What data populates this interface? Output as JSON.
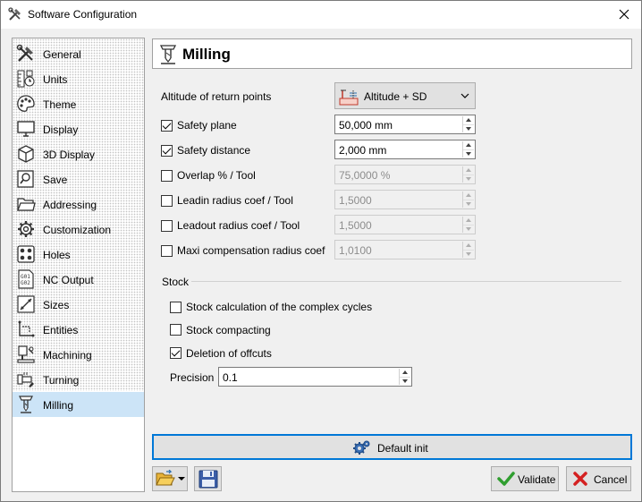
{
  "window": {
    "title": "Software Configuration"
  },
  "sidebar": {
    "items": [
      {
        "label": "General",
        "icon": "tools-icon"
      },
      {
        "label": "Units",
        "icon": "ruler-icon"
      },
      {
        "label": "Theme",
        "icon": "palette-icon"
      },
      {
        "label": "Display",
        "icon": "monitor-icon"
      },
      {
        "label": "3D Display",
        "icon": "cube-icon"
      },
      {
        "label": "Save",
        "icon": "save-magnifier-icon"
      },
      {
        "label": "Addressing",
        "icon": "folder-open-icon"
      },
      {
        "label": "Customization",
        "icon": "gear-icon"
      },
      {
        "label": "Holes",
        "icon": "holes-icon"
      },
      {
        "label": "NC Output",
        "icon": "gcode-file-icon"
      },
      {
        "label": "Sizes",
        "icon": "dimension-icon"
      },
      {
        "label": "Entities",
        "icon": "entities-icon"
      },
      {
        "label": "Machining",
        "icon": "machining-icon"
      },
      {
        "label": "Turning",
        "icon": "lathe-icon"
      },
      {
        "label": "Milling",
        "icon": "mill-icon"
      }
    ],
    "selected": "Milling"
  },
  "header": {
    "title": "Milling",
    "icon": "mill-icon"
  },
  "form": {
    "altitude": {
      "label": "Altitude of return points",
      "value": "Altitude + SD",
      "icon": "altitude-icon"
    },
    "safety_plane": {
      "label": "Safety plane",
      "value": "50,000 mm",
      "checked": true
    },
    "safety_distance": {
      "label": "Safety distance",
      "value": "2,000 mm",
      "checked": true
    },
    "overlap": {
      "label": "Overlap % / Tool",
      "value": "75,0000 %",
      "checked": false
    },
    "leadin": {
      "label": "Leadin radius coef / Tool",
      "value": "1,5000",
      "checked": false
    },
    "leadout": {
      "label": "Leadout radius coef / Tool",
      "value": "1,5000",
      "checked": false
    },
    "maxi_comp": {
      "label": "Maxi compensation radius coef",
      "value": "1,0100",
      "checked": false
    }
  },
  "stock": {
    "title": "Stock",
    "complex_cycles": {
      "label": "Stock calculation of the complex cycles",
      "checked": false
    },
    "compacting": {
      "label": "Stock compacting",
      "checked": false
    },
    "offcuts": {
      "label": "Deletion of offcuts",
      "checked": true
    },
    "precision": {
      "label": "Precision",
      "value": "0.1"
    }
  },
  "buttons": {
    "default_init": "Default init",
    "validate": "Validate",
    "cancel": "Cancel"
  },
  "colors": {
    "selection": "#cce4f7",
    "focus_border": "#0078d7",
    "validate_green": "#2f9e2f",
    "cancel_red": "#d42020"
  }
}
